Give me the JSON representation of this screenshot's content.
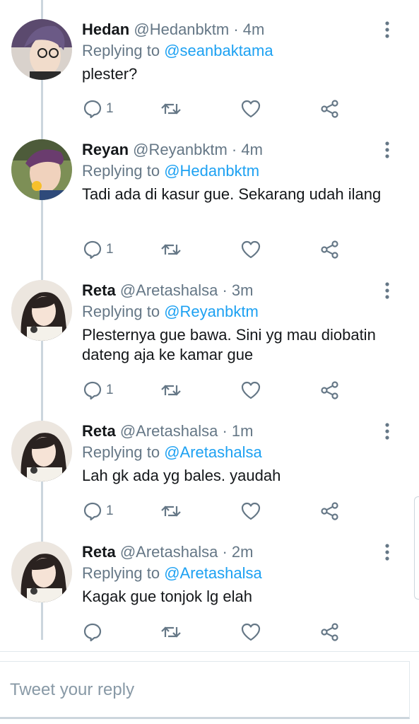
{
  "colors": {
    "accent": "#1da1f2",
    "secondary_text": "#657786",
    "primary_text": "#14171a",
    "thread_line": "#ccd6dd"
  },
  "tweets": [
    {
      "name": "Hedan",
      "handle": "@Hedanbktm",
      "separator": "·",
      "time": "4m",
      "reply_prefix": "Replying to ",
      "reply_to": "@seanbaktama",
      "text": "plester?",
      "reply_count": "1",
      "icons": [
        "reply-icon",
        "retweet-icon",
        "like-icon",
        "share-icon"
      ]
    },
    {
      "name": "Reyan",
      "handle": "@Reyanbktm",
      "separator": "·",
      "time": "4m",
      "reply_prefix": "Replying to ",
      "reply_to": "@Hedanbktm",
      "text": "Tadi ada di kasur gue. Sekarang udah ilang",
      "reply_count": "1",
      "icons": [
        "reply-icon",
        "retweet-icon",
        "like-icon",
        "share-icon"
      ]
    },
    {
      "name": "Reta",
      "handle": "@Aretashalsa",
      "separator": "·",
      "time": "3m",
      "reply_prefix": "Replying to ",
      "reply_to": "@Reyanbktm",
      "text": "Plesternya gue bawa. Sini yg mau diobatin dateng aja ke kamar gue",
      "reply_count": "1",
      "icons": [
        "reply-icon",
        "retweet-icon",
        "like-icon",
        "share-icon"
      ]
    },
    {
      "name": "Reta",
      "handle": "@Aretashalsa",
      "separator": "·",
      "time": "1m",
      "reply_prefix": "Replying to ",
      "reply_to": "@Aretashalsa",
      "text": "Lah gk ada yg bales. yaudah",
      "reply_count": "1",
      "icons": [
        "reply-icon",
        "retweet-icon",
        "like-icon",
        "share-icon"
      ]
    },
    {
      "name": "Reta",
      "handle": "@Aretashalsa",
      "separator": "·",
      "time": "2m",
      "reply_prefix": "Replying to ",
      "reply_to": "@Aretashalsa",
      "text": "Kagak gue tonjok lg elah",
      "reply_count": "",
      "icons": [
        "reply-icon",
        "retweet-icon",
        "like-icon",
        "share-icon"
      ]
    }
  ],
  "compose": {
    "placeholder": "Tweet your reply"
  }
}
